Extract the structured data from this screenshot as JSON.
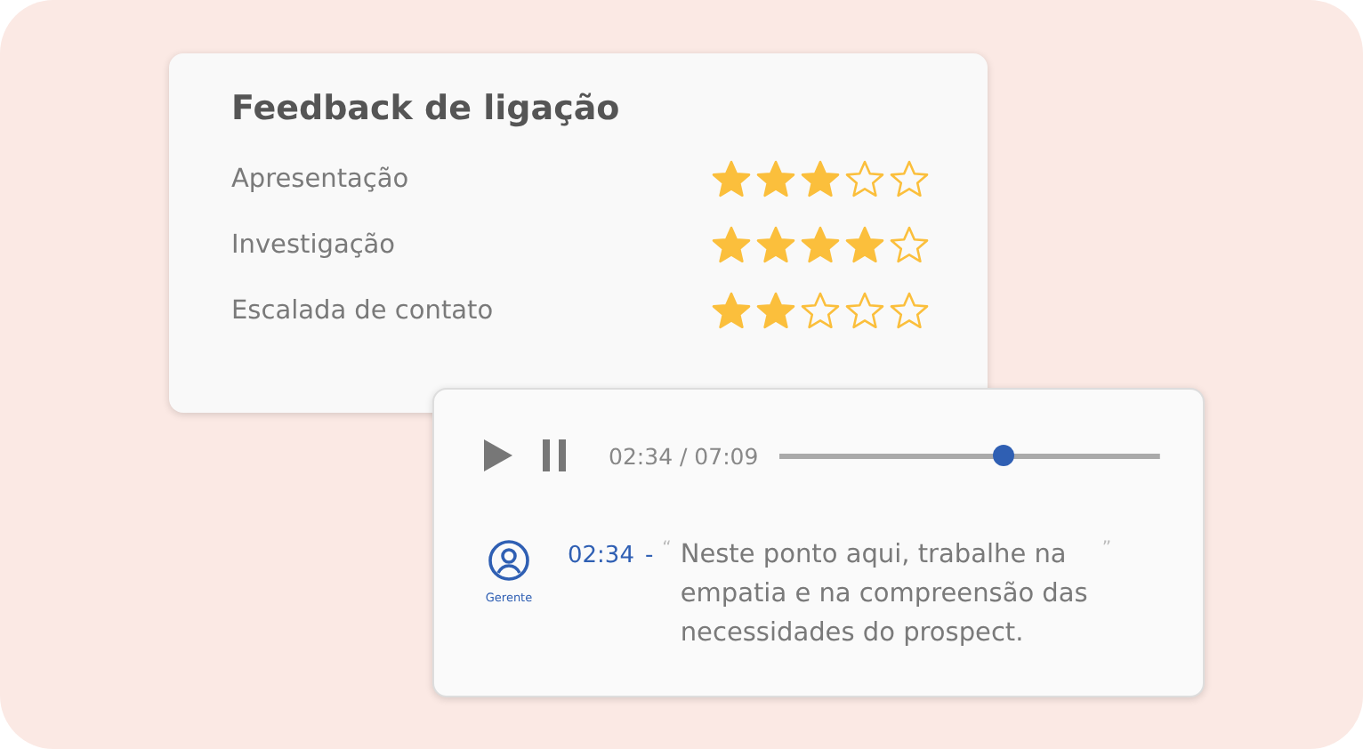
{
  "feedback": {
    "title": "Feedback de ligação",
    "criteria": [
      {
        "label": "Apresentação",
        "stars": 3
      },
      {
        "label": "Investigação",
        "stars": 4
      },
      {
        "label": "Escalada de contato",
        "stars": 2
      }
    ]
  },
  "player": {
    "time": "02:34 / 07:09",
    "level": 0.59
  },
  "comment": {
    "author": "Gerente",
    "timestamp": "02:34",
    "separator": "-",
    "open_quote": "“",
    "text": "Neste ponto aqui, trabalhe na empatia e na compreensão das necessidades do prospect.",
    "close_quote": "”"
  }
}
